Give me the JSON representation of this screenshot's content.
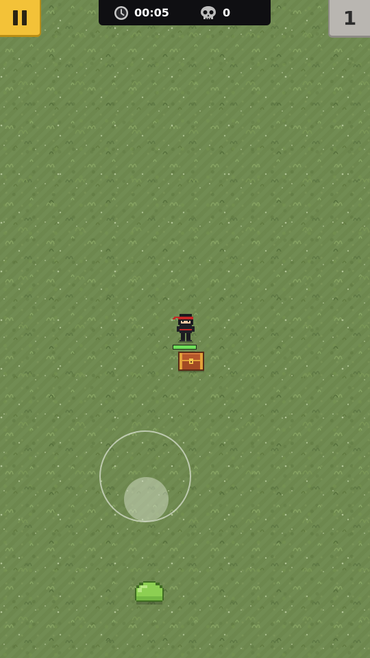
{
  "hud": {
    "pause_icon": "pause-icon",
    "timer": {
      "icon": "clock-icon",
      "value": "00:05"
    },
    "kills": {
      "icon": "skull-icon",
      "value": "0"
    },
    "level": "1"
  },
  "player": {
    "character": "ninja",
    "health_fraction": 1.0
  },
  "objects": [
    {
      "type": "treasure-chest"
    },
    {
      "type": "green-slime"
    }
  ],
  "joystick": {
    "state": "idle"
  },
  "colors": {
    "pause_button": "#f3c238",
    "top_bar": "#0f0f12",
    "level_box": "#b9b6b1",
    "grass": "#6f8a50",
    "health": "#6fe05a"
  }
}
